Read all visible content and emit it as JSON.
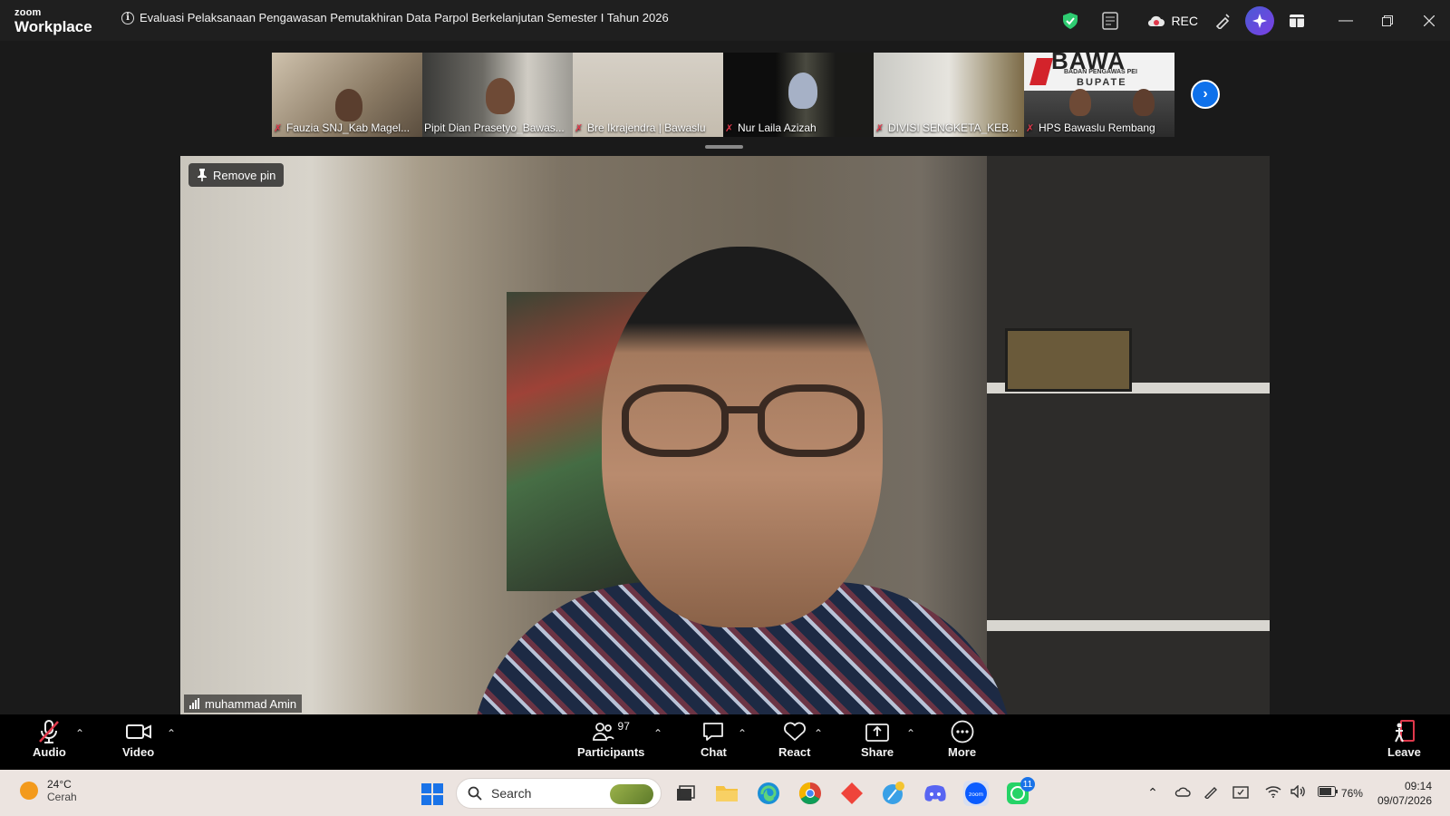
{
  "app": {
    "brand_small": "zoom",
    "brand_big": "Workplace"
  },
  "meeting": {
    "title": "Evaluasi Pelaksanaan Pengawasan Pemutakhiran Data Parpol Berkelanjutan Semester I Tahun 2026"
  },
  "titlebar": {
    "rec_label": "REC"
  },
  "filmstrip": {
    "tiles": [
      {
        "name": "Fauzia SNJ_Kab Magel...",
        "muted": true
      },
      {
        "name": "Pipit Dian Prasetyo_Bawas...",
        "muted": false
      },
      {
        "name": "Bre Ikrajendra | Bawaslu",
        "muted": true
      },
      {
        "name": "Nur Laila Azizah",
        "muted": true
      },
      {
        "name": "DIVISI SENGKETA_KEB...",
        "muted": true
      },
      {
        "name": "HPS Bawaslu Rembang",
        "muted": true
      }
    ],
    "banner_text": "BAWA",
    "banner_sub": "BADAN PENGAWAS PEI",
    "banner_sub2": "BUPATE"
  },
  "main_video": {
    "remove_pin_label": "Remove pin",
    "speaker_name": "muhammad Amin"
  },
  "toolbar": {
    "audio": "Audio",
    "video": "Video",
    "participants": "Participants",
    "participants_count": "97",
    "chat": "Chat",
    "react": "React",
    "share": "Share",
    "more": "More",
    "leave": "Leave"
  },
  "taskbar": {
    "weather_temp": "24°C",
    "weather_desc": "Cerah",
    "search_placeholder": "Search",
    "whatsapp_badge": "11",
    "battery": "76%",
    "time": "09:14",
    "date": "09/07/2026"
  },
  "colors": {
    "accent": "#0e71eb",
    "mute_red": "#e0384b",
    "shield_green": "#2ecc71"
  }
}
